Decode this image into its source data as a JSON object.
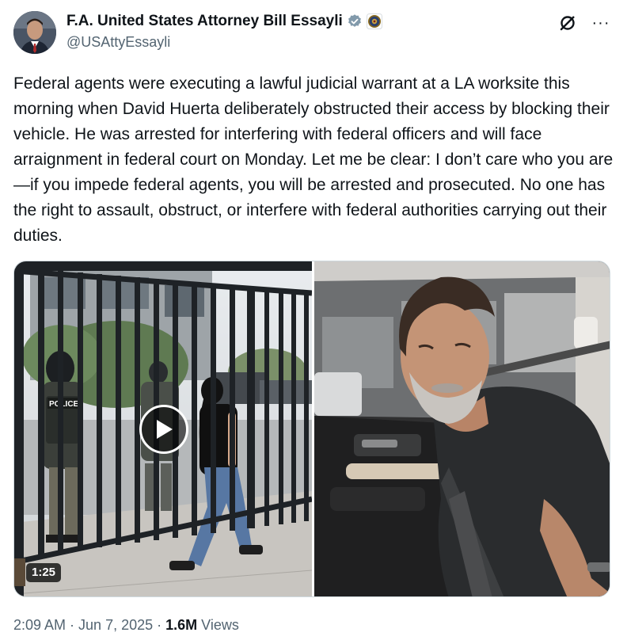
{
  "author": {
    "display_name": "F.A. United States Attorney Bill Essayli",
    "handle": "@USAttyEssayli",
    "verified_badge_icon": "gray-verified-badge-icon",
    "affiliation_icon": "doj-seal-icon"
  },
  "actions": {
    "grok_icon": "grok-icon",
    "more_label": "···"
  },
  "tweet": {
    "text": "Federal agents were executing a lawful judicial warrant at a LA worksite this morning when David Huerta deliberately obstructed their access by blocking their vehicle. He was arrested for interfering with federal officers and will face arraignment in federal court on Monday. Let me be clear: I don’t care who you are—if you impede federal agents, you will be arrested and prosecuted. No one has the right to assault, obstruct, or interfere with federal authorities carrying out their duties."
  },
  "media": {
    "video": {
      "duration": "1:25",
      "vest_label": "POLICE"
    }
  },
  "meta": {
    "time": "2:09 AM",
    "separator": " · ",
    "date": "Jun 7, 2025",
    "views_count": "1.6M",
    "views_label": "Views"
  },
  "colors": {
    "text_primary": "#0f1419",
    "text_secondary": "#536471",
    "verified_gray": "#829aab",
    "border": "#cfd9de"
  }
}
